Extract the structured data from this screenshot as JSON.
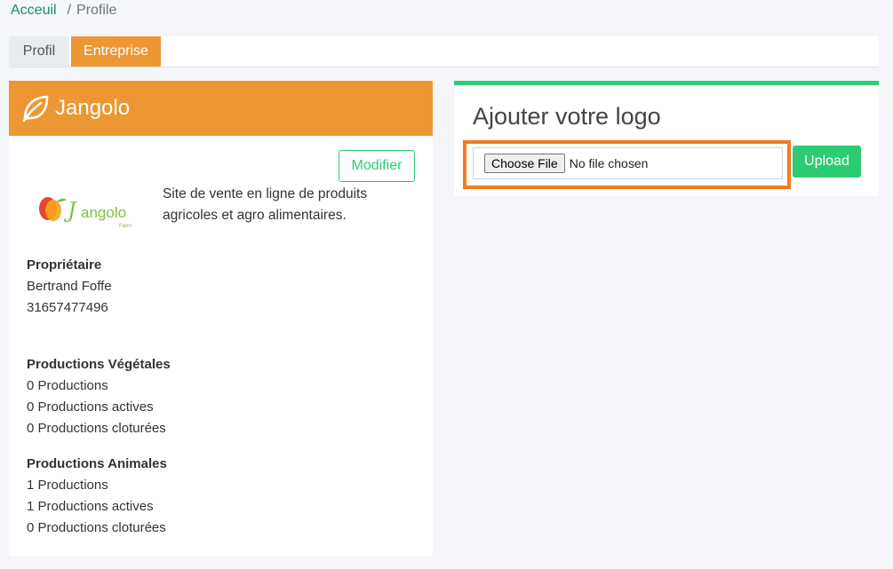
{
  "breadcrumb": {
    "home": "Acceuil",
    "separator": "/",
    "current": "Profile"
  },
  "tabs": [
    {
      "label": "Profil",
      "active": false
    },
    {
      "label": "Entreprise",
      "active": true
    }
  ],
  "company": {
    "name": "Jangolo",
    "header_icon": "leaf-icon",
    "edit_label": "Modifier",
    "logo_text": "Jangolo",
    "logo_subtext": "Farm",
    "description": "Site de vente en ligne de produits agricoles et agro alimentaires."
  },
  "owner": {
    "heading": "Propriétaire",
    "name": "Bertrand Foffe",
    "phone": "31657477496"
  },
  "vegetal": {
    "heading": "Productions Végétales",
    "lines": [
      "0 Productions",
      "0 Productions actives",
      "0 Productions cloturées"
    ]
  },
  "animal": {
    "heading": "Productions Animales",
    "lines": [
      "1 Productions",
      "1 Productions actives",
      "0 Productions cloturées"
    ]
  },
  "logo_upload": {
    "title": "Ajouter votre logo",
    "choose_label": "Choose File",
    "status": "No file chosen",
    "upload_label": "Upload"
  },
  "colors": {
    "accent_orange": "#ed9732",
    "accent_green": "#2ecc71",
    "highlight": "#f47a20",
    "link": "#1e8a6e"
  }
}
